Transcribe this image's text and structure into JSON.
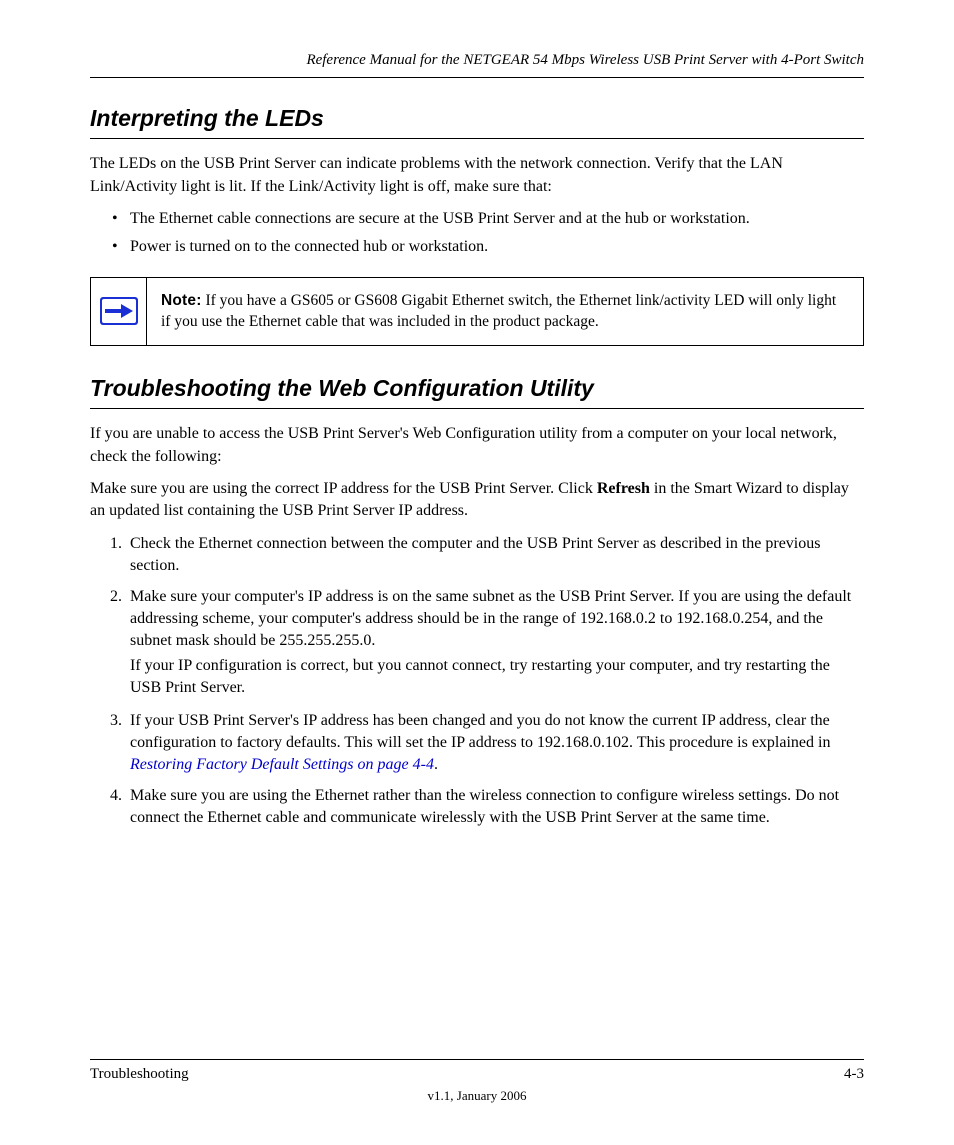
{
  "header": {
    "title": "Reference Manual for the NETGEAR 54 Mbps Wireless USB Print Server with 4-Port Switch"
  },
  "section1": {
    "heading": "Interpreting the LEDs",
    "intro": "The LEDs on the USB Print Server can indicate problems with the network connection. Verify that the LAN Link/Activity light is lit. If the Link/Activity light is off, make sure that:",
    "bullets": [
      "The Ethernet cable connections are secure at the USB Print Server and at the hub or workstation.",
      "Power is turned on to the connected hub or workstation."
    ],
    "noteLabel": "Note:",
    "noteText": " If you have a GS605 or GS608 Gigabit Ethernet switch, the Ethernet link/activity LED will only light if you use the Ethernet cable that was included in the product package."
  },
  "section2": {
    "heading": "Troubleshooting the Web Configuration Utility",
    "intro_a": "If you are unable to access the USB Print Server's Web Configuration utility from a computer on your local network, check the following:",
    "intro_b": "Make sure you are using the correct IP address for the USB Print Server. Click ",
    "intro_b_bold": "Refresh",
    "intro_b_after": " in the Smart Wizard to display an updated list containing the USB Print Server IP address.",
    "steps": [
      "Check the Ethernet connection between the computer and the USB Print Server as described in the previous section.",
      {
        "pre": "Make sure your computer's IP address is on the same subnet as the USB Print Server. If you are using the default addressing scheme, your computer's address should be in the range of 192.168.0.2 to 192.168.0.254, and the subnet mask should be 255.255.255.0.",
        "ifclause": "If your IP configuration is correct, but you cannot connect, try restarting your computer, and try restarting the USB Print Server."
      },
      {
        "pre": "If your USB Print Server's IP address has been changed and you do not know the current IP address, clear the configuration to factory defaults. This will set the IP address to 192.168.0.102. This procedure is explained in ",
        "linkText": "Restoring Factory Default Settings",
        "linkPage": " on page 4-4",
        "post": "."
      },
      "Make sure you are using the Ethernet rather than the wireless connection to configure wireless settings. Do not connect the Ethernet cable and communicate wirelessly with the USB Print Server at the same time."
    ]
  },
  "footer": {
    "left": "Troubleshooting",
    "right": "4-3",
    "sub": "v1.1, January 2006"
  }
}
